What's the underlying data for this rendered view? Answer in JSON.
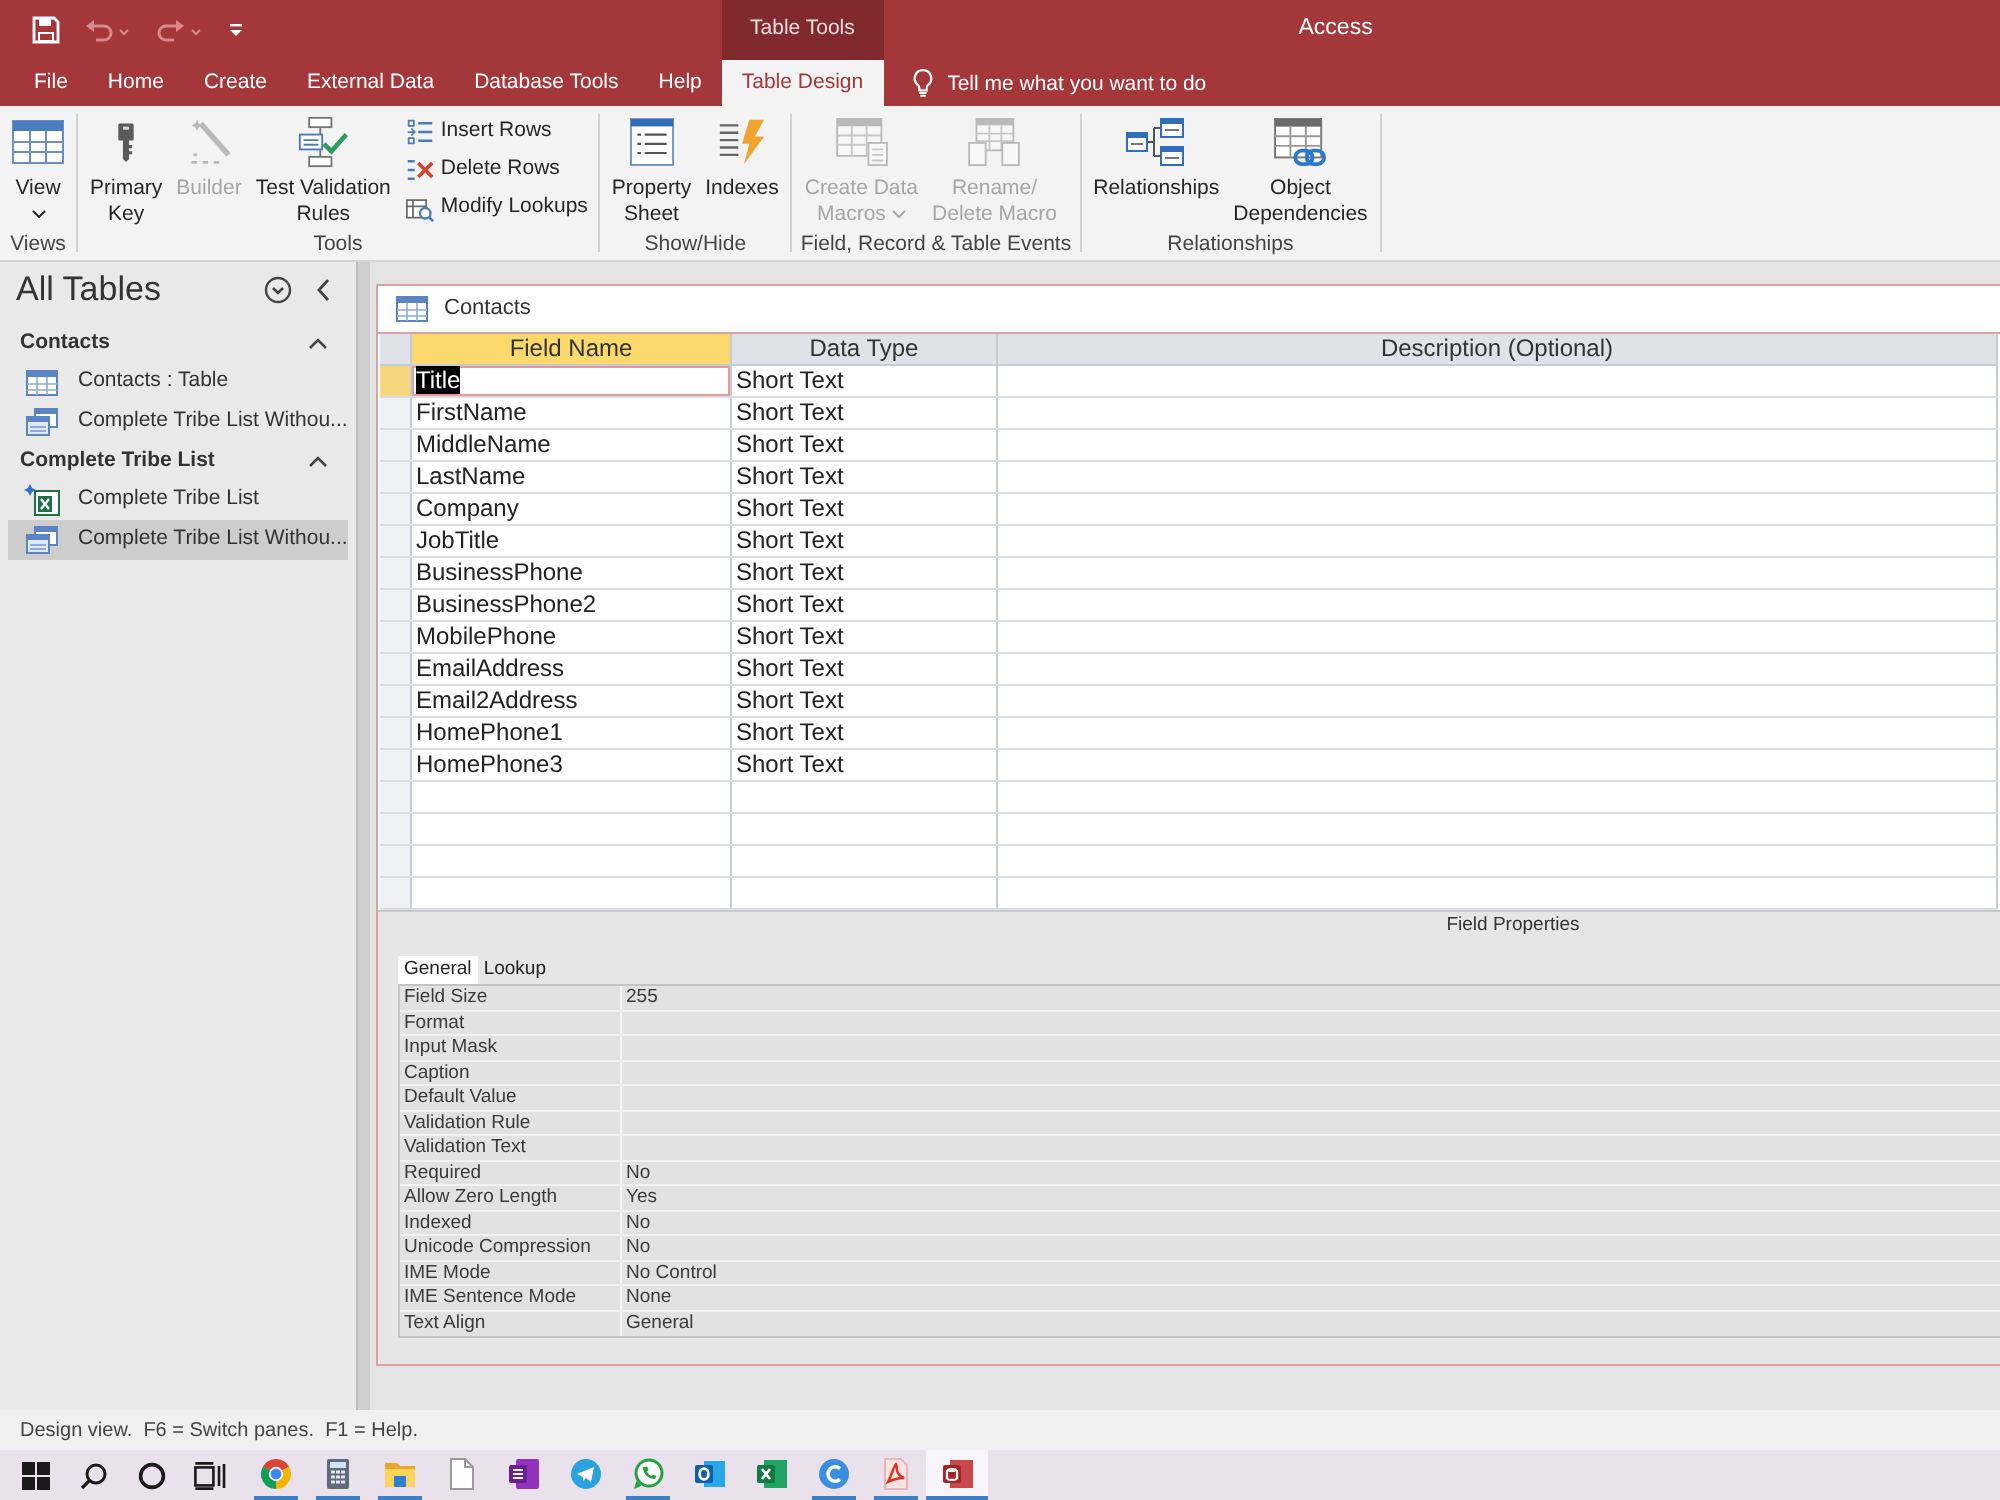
{
  "quick_access": [
    {
      "kind": "save",
      "disabled": false
    },
    {
      "kind": "undo",
      "disabled": true
    },
    {
      "kind": "redo",
      "disabled": true
    },
    {
      "kind": "customize",
      "disabled": false
    }
  ],
  "title_bar": {
    "title": "Access"
  },
  "ribbon_tabs": [
    {
      "label": "File",
      "selected": false
    },
    {
      "label": "Home",
      "selected": false
    },
    {
      "label": "Create",
      "selected": false
    },
    {
      "label": "External Data",
      "selected": false
    },
    {
      "label": "Database Tools",
      "selected": false
    },
    {
      "label": "Help",
      "selected": false
    }
  ],
  "context_tabs": {
    "group": "Table Tools",
    "tabs": [
      {
        "label": "Table Design",
        "selected": true
      }
    ]
  },
  "tell_me": {
    "placeholder": "Tell me what you want to do"
  },
  "ribbon_groups": [
    {
      "label": "Views",
      "commands": [
        {
          "kind": "large",
          "label": "View",
          "dropdown": true,
          "disabled": false
        }
      ]
    },
    {
      "label": "Tools",
      "commands": [
        {
          "kind": "large",
          "label": "Primary\nKey",
          "dropdown": false,
          "disabled": false
        },
        {
          "kind": "large",
          "label": "Builder",
          "dropdown": false,
          "disabled": true
        },
        {
          "kind": "large",
          "label": "Test Validation\nRules",
          "dropdown": false,
          "disabled": false
        },
        {
          "kind": "stack",
          "items": [
            {
              "label": "Insert Rows",
              "disabled": false
            },
            {
              "label": "Delete Rows",
              "disabled": false
            },
            {
              "label": "Modify Lookups",
              "disabled": false
            }
          ]
        }
      ]
    },
    {
      "label": "Show/Hide",
      "commands": [
        {
          "kind": "large",
          "label": "Property\nSheet",
          "dropdown": false,
          "disabled": false
        },
        {
          "kind": "large",
          "label": "Indexes",
          "dropdown": false,
          "disabled": false
        }
      ]
    },
    {
      "label": "Field, Record & Table Events",
      "commands": [
        {
          "kind": "large",
          "label": "Create Data\nMacros",
          "dropdown": true,
          "disabled": true
        },
        {
          "kind": "large",
          "label": "Rename/\nDelete Macro",
          "dropdown": false,
          "disabled": true
        }
      ]
    },
    {
      "label": "Relationships",
      "commands": [
        {
          "kind": "large",
          "label": "Relationships",
          "dropdown": false,
          "disabled": false
        },
        {
          "kind": "large",
          "label": "Object\nDependencies",
          "dropdown": false,
          "disabled": false
        }
      ]
    }
  ],
  "nav_pane": {
    "title": "All Tables",
    "groups": [
      {
        "label": "Contacts",
        "expanded": true,
        "items": [
          {
            "kind": "table",
            "label": "Contacts : Table",
            "selected": false
          },
          {
            "kind": "query",
            "label": "Complete Tribe List Withou...",
            "selected": false
          }
        ]
      },
      {
        "label": "Complete Tribe List",
        "expanded": true,
        "items": [
          {
            "kind": "linked_excel",
            "label": "Complete Tribe List",
            "selected": false
          },
          {
            "kind": "query",
            "label": "Complete Tribe List Withou...",
            "selected": true
          }
        ]
      }
    ]
  },
  "document": {
    "tab": "Contacts",
    "columns": [
      {
        "label": "Field Name",
        "selected": true
      },
      {
        "label": "Data Type",
        "selected": false
      },
      {
        "label": "Description (Optional)",
        "selected": false
      }
    ],
    "rows": [
      {
        "field_name": "Title",
        "data_type": "Short Text",
        "selected": true
      },
      {
        "field_name": "FirstName",
        "data_type": "Short Text",
        "selected": false
      },
      {
        "field_name": "MiddleName",
        "data_type": "Short Text",
        "selected": false
      },
      {
        "field_name": "LastName",
        "data_type": "Short Text",
        "selected": false
      },
      {
        "field_name": "Company",
        "data_type": "Short Text",
        "selected": false
      },
      {
        "field_name": "JobTitle",
        "data_type": "Short Text",
        "selected": false
      },
      {
        "field_name": "BusinessPhone",
        "data_type": "Short Text",
        "selected": false
      },
      {
        "field_name": "BusinessPhone2",
        "data_type": "Short Text",
        "selected": false
      },
      {
        "field_name": "MobilePhone",
        "data_type": "Short Text",
        "selected": false
      },
      {
        "field_name": "EmailAddress",
        "data_type": "Short Text",
        "selected": false
      },
      {
        "field_name": "Email2Address",
        "data_type": "Short Text",
        "selected": false
      },
      {
        "field_name": "HomePhone1",
        "data_type": "Short Text",
        "selected": false
      },
      {
        "field_name": "HomePhone3",
        "data_type": "Short Text",
        "selected": false
      }
    ]
  },
  "field_properties": {
    "title": "Field Properties",
    "tabs": [
      {
        "label": "General",
        "selected": true
      },
      {
        "label": "Lookup",
        "selected": false
      }
    ],
    "properties": [
      {
        "name": "Field Size",
        "value": "255"
      },
      {
        "name": "Format"
      },
      {
        "name": "Input Mask"
      },
      {
        "name": "Caption"
      },
      {
        "name": "Default Value"
      },
      {
        "name": "Validation Rule"
      },
      {
        "name": "Validation Text"
      },
      {
        "name": "Required",
        "value": "No"
      },
      {
        "name": "Allow Zero Length",
        "value": "Yes"
      },
      {
        "name": "Indexed",
        "value": "No"
      },
      {
        "name": "Unicode Compression",
        "value": "No"
      },
      {
        "name": "IME Mode",
        "value": "No Control"
      },
      {
        "name": "IME Sentence Mode",
        "value": "None"
      },
      {
        "name": "Text Align",
        "value": "General"
      }
    ]
  },
  "status_bar": {
    "text": "Design view.  F6 = Switch panes.  F1 = Help."
  },
  "taskbar": {
    "apps": [
      {
        "kind": "browser",
        "running": true,
        "selected": false
      },
      {
        "kind": "calculator",
        "running": true,
        "selected": false
      },
      {
        "kind": "folder",
        "running": true,
        "selected": false
      },
      {
        "kind": "document",
        "running": false,
        "selected": false
      },
      {
        "kind": "notebook",
        "running": false,
        "selected": false
      },
      {
        "kind": "messenger",
        "running": false,
        "selected": false
      },
      {
        "kind": "chat",
        "running": true,
        "selected": false
      },
      {
        "kind": "mail",
        "running": false,
        "selected": false
      },
      {
        "kind": "spreadsheet",
        "running": false,
        "selected": false
      },
      {
        "kind": "design",
        "running": true,
        "selected": false
      },
      {
        "kind": "pdf",
        "running": true,
        "selected": false
      },
      {
        "kind": "database",
        "running": true,
        "selected": true
      }
    ]
  }
}
